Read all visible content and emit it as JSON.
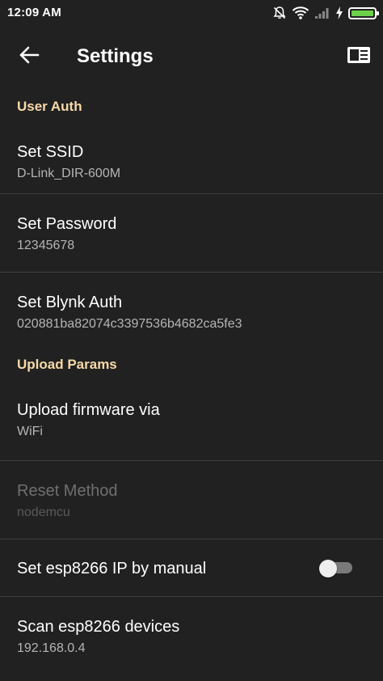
{
  "status_bar": {
    "time": "12:09 AM",
    "icons": [
      "mute-notifications-icon",
      "wifi-icon",
      "cellular-signal-icon",
      "charging-bolt-icon",
      "battery-icon"
    ],
    "battery_color": "#6bd24a"
  },
  "app_bar": {
    "title": "Settings",
    "back_icon": "arrow-back-icon",
    "menu_icon": "sidebar-panel-icon"
  },
  "sections": {
    "user_auth": {
      "header": "User Auth",
      "items": [
        {
          "title": "Set SSID",
          "summary": "D-Link_DIR-600M"
        },
        {
          "title": "Set Password",
          "summary": "12345678"
        },
        {
          "title": "Set Blynk Auth",
          "summary": "020881ba82074c3397536b4682ca5fe3"
        }
      ]
    },
    "upload_params": {
      "header": "Upload Params",
      "items": [
        {
          "title": "Upload firmware via",
          "summary": "WiFi"
        },
        {
          "title": "Reset Method",
          "summary": "nodemcu",
          "enabled": false
        },
        {
          "title": "Set esp8266 IP by manual",
          "switch_on": false
        },
        {
          "title": "Scan esp8266 devices",
          "summary": "192.168.0.4"
        }
      ]
    }
  },
  "colors": {
    "background": "#212121",
    "category_header": "#f7d9a8",
    "divider": "#3e3e3e"
  }
}
